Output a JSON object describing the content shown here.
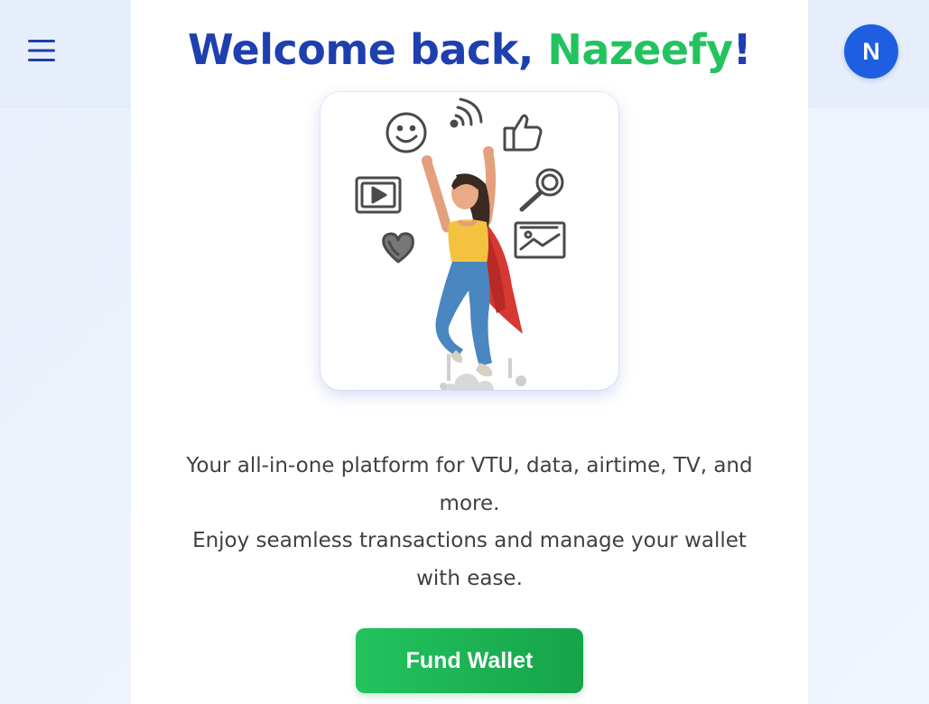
{
  "header": {
    "menu_icon": "hamburger-menu-icon",
    "avatar_initial": "N",
    "colors": {
      "avatar_bg": "#1d5fe0",
      "menu_icon": "#1f3fa8"
    }
  },
  "welcome": {
    "prefix": "Welcome back, ",
    "name": "Nazeefy",
    "suffix": "!",
    "colors": {
      "title": "#1e3fae",
      "name": "#22c35e"
    }
  },
  "hero_image": {
    "alt": "Woman with cape reaching up surrounded by social media icons",
    "icons": [
      "smiley-icon",
      "wifi-signal-icon",
      "thumbs-up-icon",
      "video-play-icon",
      "search-icon",
      "image-icon",
      "heart-icon"
    ]
  },
  "tagline": {
    "line1": "Your all-in-one platform for VTU, data, airtime, TV, and more.",
    "line2": "Enjoy seamless transactions and manage your wallet with ease."
  },
  "actions": {
    "fund_wallet_label": "Fund Wallet",
    "colors": {
      "button_start": "#22c35e",
      "button_end": "#17a34a"
    }
  }
}
